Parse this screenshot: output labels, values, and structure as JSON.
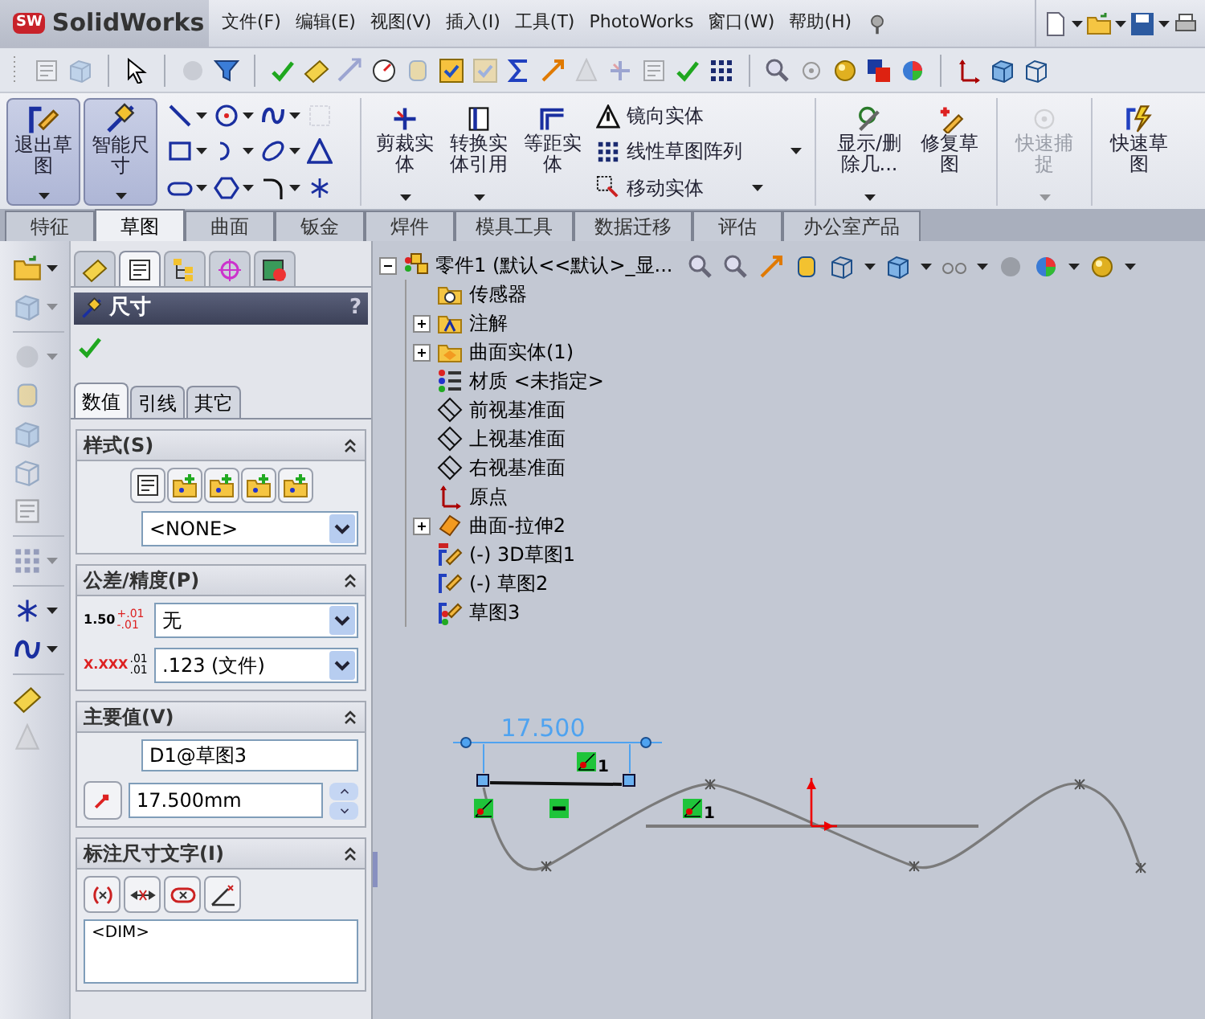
{
  "app": {
    "badge": "SW",
    "name": "SolidWorks"
  },
  "menu": [
    {
      "label": "文件(F)"
    },
    {
      "label": "编辑(E)"
    },
    {
      "label": "视图(V)"
    },
    {
      "label": "插入(I)"
    },
    {
      "label": "工具(T)"
    },
    {
      "label": "PhotoWorks"
    },
    {
      "label": "窗口(W)"
    },
    {
      "label": "帮助(H)"
    }
  ],
  "ribbon": {
    "large": [
      {
        "label": "退出草图",
        "pressed": true
      },
      {
        "label": "智能尺寸",
        "pressed": true
      }
    ],
    "tools": [
      {
        "label": "剪裁实体"
      },
      {
        "label": "转换实体引用"
      },
      {
        "label": "等距实体"
      }
    ],
    "list": [
      {
        "label": "镜向实体"
      },
      {
        "label": "线性草图阵列"
      },
      {
        "label": "移动实体"
      }
    ],
    "more": [
      {
        "label": "显示/删除几...",
        "disabled": false
      },
      {
        "label": "修复草图",
        "disabled": false
      },
      {
        "label": "快速捕捉",
        "disabled": true
      },
      {
        "label": "快速草图",
        "disabled": false
      }
    ]
  },
  "tabs": [
    {
      "label": "特征",
      "selected": false
    },
    {
      "label": "草图",
      "selected": true
    },
    {
      "label": "曲面",
      "selected": false
    },
    {
      "label": "钣金",
      "selected": false
    },
    {
      "label": "焊件",
      "selected": false
    },
    {
      "label": "模具工具",
      "selected": false
    },
    {
      "label": "数据迁移",
      "selected": false
    },
    {
      "label": "评估",
      "selected": false
    },
    {
      "label": "办公室产品",
      "selected": false
    }
  ],
  "manager_tabs": [
    {
      "selected": false
    },
    {
      "selected": true
    },
    {
      "selected": false
    },
    {
      "selected": false
    },
    {
      "selected": false
    }
  ],
  "property_manager": {
    "title": "尺寸",
    "help": "?",
    "subtabs": [
      {
        "label": "数值",
        "selected": true
      },
      {
        "label": "引线",
        "selected": false
      },
      {
        "label": "其它",
        "selected": false
      }
    ],
    "style": {
      "title": "样式(S)",
      "select": "<NONE>"
    },
    "tolerance": {
      "title": "公差/精度(P)",
      "tolerance_sample": {
        "value": "1.50",
        "upper": "+.01",
        "lower": "-.01"
      },
      "tolerance_select": "无",
      "precision_sample": {
        "value": "X.XXX",
        "upper": ".01",
        "lower": ".01"
      },
      "precision_select": ".123 (文件)"
    },
    "primary": {
      "title": "主要值(V)",
      "name": "D1@草图3",
      "value": "17.500mm"
    },
    "dim_text": {
      "title": "标注尺寸文字(I)",
      "text": "<DIM>"
    }
  },
  "tree": {
    "label": "零件1  (默认<<默认>_显...",
    "kind": "part",
    "expanded": true,
    "children": [
      {
        "label": "传感器",
        "kind": "sensors"
      },
      {
        "label": "注解",
        "kind": "annotations",
        "expanded": false
      },
      {
        "label": "曲面实体(1)",
        "kind": "bodies",
        "expanded": false
      },
      {
        "label": "材质 <未指定>",
        "kind": "material"
      },
      {
        "label": "前视基准面",
        "kind": "plane"
      },
      {
        "label": "上视基准面",
        "kind": "plane"
      },
      {
        "label": "右视基准面",
        "kind": "plane"
      },
      {
        "label": "原点",
        "kind": "origin"
      },
      {
        "label": "曲面-拉伸2",
        "kind": "feature",
        "expanded": false
      },
      {
        "label": "(-) 3D草图1",
        "kind": "sketch3d"
      },
      {
        "label": "(-) 草图2",
        "kind": "sketch"
      },
      {
        "label": "草图3",
        "kind": "sketch_active"
      }
    ]
  },
  "sketch": {
    "dimension": "17.500",
    "relations": [
      {
        "kind": "coincident",
        "count": "1"
      },
      {
        "kind": "coincident"
      },
      {
        "kind": "horizontal"
      },
      {
        "kind": "coincident",
        "count": "1"
      }
    ]
  }
}
